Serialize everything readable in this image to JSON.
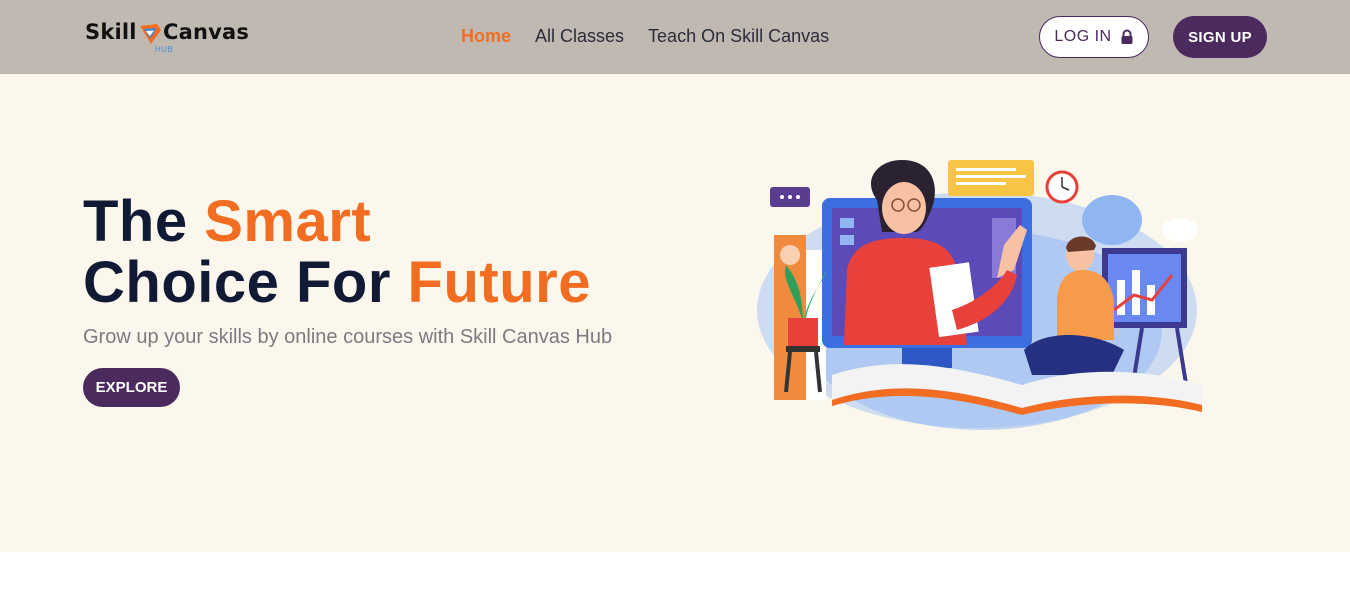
{
  "brand": {
    "name_part1": "Skill",
    "name_part2": "Canvas",
    "sub": "HUB",
    "accent_color": "#f26d21",
    "primary_color": "#4b2a5e"
  },
  "nav": {
    "links": [
      {
        "label": "Home",
        "active": true
      },
      {
        "label": "All Classes",
        "active": false
      },
      {
        "label": "Teach On Skill Canvas",
        "active": false
      }
    ],
    "login_label": "LOG IN",
    "login_icon": "lock-icon",
    "signup_label": "SIGN UP"
  },
  "hero": {
    "title_part1": "The ",
    "title_accent1": "Smart",
    "title_part2": "Choice For ",
    "title_accent2": "Future",
    "subtitle": "Grow up your skills by online courses with Skill Canvas Hub",
    "cta_label": "EXPLORE",
    "illustration": "online-learning-illustration"
  }
}
